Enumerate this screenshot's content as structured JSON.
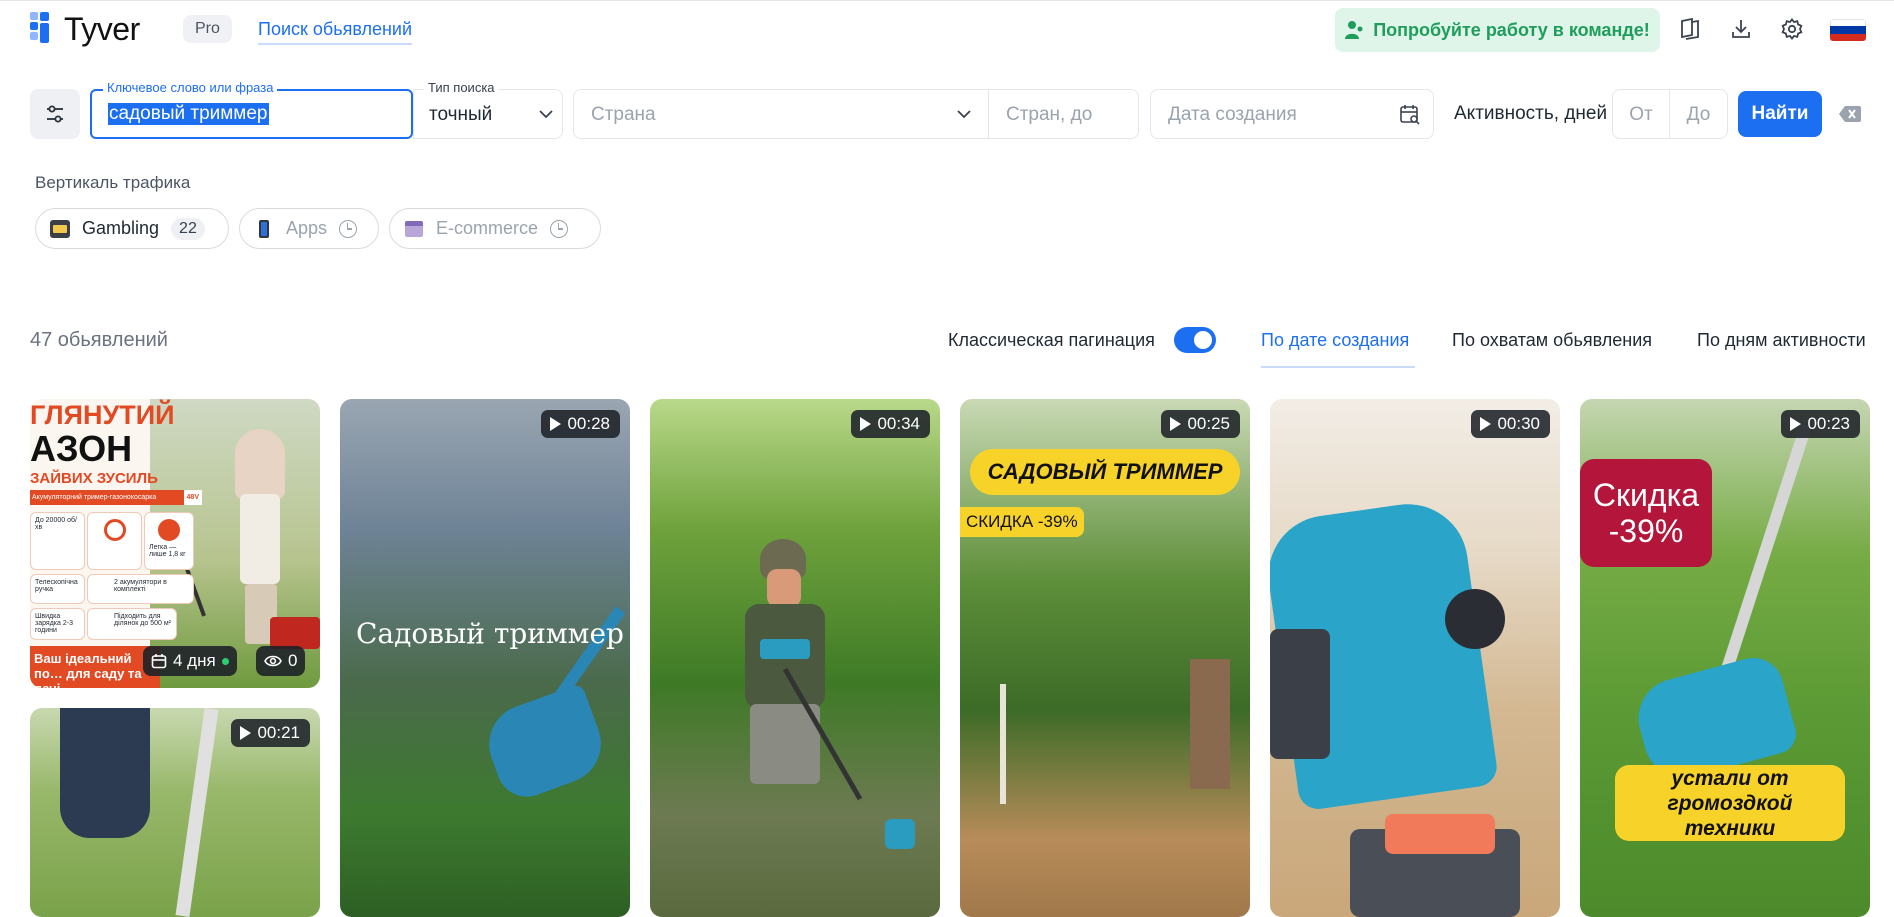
{
  "header": {
    "logo_text": "Tyver",
    "pro_badge": "Pro",
    "search_link": "Поиск обьявлений",
    "team_button": "Попробуйте работу в команде!",
    "icons": [
      "guide-book-icon",
      "download-icon",
      "settings-icon",
      "russia-flag-icon"
    ]
  },
  "filters": {
    "keyword_label": "Ключевое слово или фраза",
    "keyword_value": "садовый триммер",
    "search_type_label": "Тип поиска",
    "search_type_value": "точный",
    "country_placeholder": "Страна",
    "country_to_placeholder": "Стран, до",
    "date_placeholder": "Дата создания",
    "activity_label": "Активность, дней",
    "activity_from": "От",
    "activity_to": "До",
    "find_button": "Найти"
  },
  "vertical": {
    "label": "Вертикаль трафика",
    "chips": [
      {
        "label": "Gambling",
        "count": "22",
        "active": true
      },
      {
        "label": "Apps",
        "active": false
      },
      {
        "label": "E-commerce",
        "active": false
      }
    ]
  },
  "results": {
    "count_text": "47 обьявлений",
    "pagination_label": "Классическая пагинация",
    "pagination_on": true,
    "sort_tabs": [
      "По дате создания",
      "По охватам обьявления",
      "По дням активности"
    ],
    "active_sort": "По дате создания"
  },
  "cards": [
    {
      "durations": [],
      "overlay_lines": [
        "ГЛЯНУТИЙ",
        "АЗОН",
        "ЗАЙВИХ ЗУСИЛЬ"
      ],
      "tag": "Акумуляторний тример-газонокосарка",
      "tag_volt": "48V",
      "features": [
        "До 20000 об/хв",
        "Легка — лише 1,8 кг",
        "Телескопічна ручка",
        "2 акумулятори в комплекті",
        "Швидка зарядка 2-3 години",
        "Підходить для ділянок до 500 м²"
      ],
      "footer_text": "Ваш ідеальний по… для саду та дачі",
      "days": "4 дня",
      "views": "0"
    },
    {
      "duration": "00:28",
      "overlay": "Садовый триммер"
    },
    {
      "duration": "00:34"
    },
    {
      "duration": "00:25",
      "overlay": "САДОВЫЙ ТРИММЕР",
      "overlay2": "СКИДКА -39%"
    },
    {
      "duration": "00:30"
    },
    {
      "duration": "00:23",
      "overlay": "Скидка -39%",
      "overlay2": "устали от громоздкой техники"
    },
    {
      "duration": "00:21"
    }
  ],
  "colors": {
    "primary": "#1d6ff2",
    "team_bg": "#dff5ea",
    "team_text": "#1f9d5b"
  }
}
